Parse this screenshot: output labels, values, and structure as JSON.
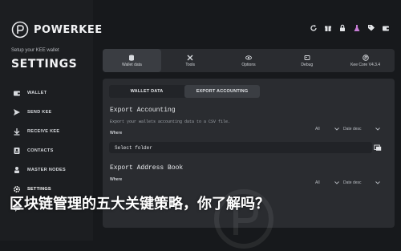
{
  "brand": {
    "name": "POWERKEE",
    "logo_icon": "power-icon"
  },
  "sidebar": {
    "setup_text": "Setup your KEE wallet",
    "title": "SETTINGS",
    "items": [
      {
        "label": "WALLET",
        "icon": "wallet-icon"
      },
      {
        "label": "SEND KEE",
        "icon": "send-icon"
      },
      {
        "label": "RECEIVE KEE",
        "icon": "receive-icon"
      },
      {
        "label": "CONTACTS",
        "icon": "contacts-icon"
      },
      {
        "label": "MASTER NODES",
        "icon": "master-nodes-icon"
      },
      {
        "label": "SETTINGS",
        "icon": "settings-icon"
      },
      {
        "label": "",
        "icon": "chat-icon"
      }
    ]
  },
  "topbar": {
    "icons": [
      "refresh-icon",
      "gift-icon",
      "lock-icon",
      "flask-icon",
      "tag-icon",
      "wallet-icon"
    ]
  },
  "tabs": [
    {
      "label": "Wallet data",
      "icon": "database-icon",
      "active": true
    },
    {
      "label": "Tools",
      "icon": "tools-icon",
      "active": false
    },
    {
      "label": "Options",
      "icon": "eye-icon",
      "active": false
    },
    {
      "label": "Debug",
      "icon": "debug-icon",
      "active": false
    },
    {
      "label": "Kee Core V4.3.4",
      "icon": "logo-icon",
      "active": false
    }
  ],
  "subtabs": [
    {
      "label": "WALLET DATA",
      "active": false
    },
    {
      "label": "EXPORT ACCOUNTING",
      "active": true
    }
  ],
  "export_accounting": {
    "title": "Export Accounting",
    "desc": "Export your wallets accounting data to a CSV file.",
    "where_label": "Where",
    "filter_all": "All",
    "filter_date": "Date desc",
    "input_value": "Select folder"
  },
  "export_address_book": {
    "title": "Export Address Book",
    "where_label": "Where",
    "filter_all": "All",
    "filter_date": "Date desc"
  },
  "overlay_text": "区块链管理的五大关键策略，你了解吗？",
  "colors": {
    "background": "#17191c",
    "panel": "#2a2c30",
    "sidebar": "#1c1e21"
  }
}
